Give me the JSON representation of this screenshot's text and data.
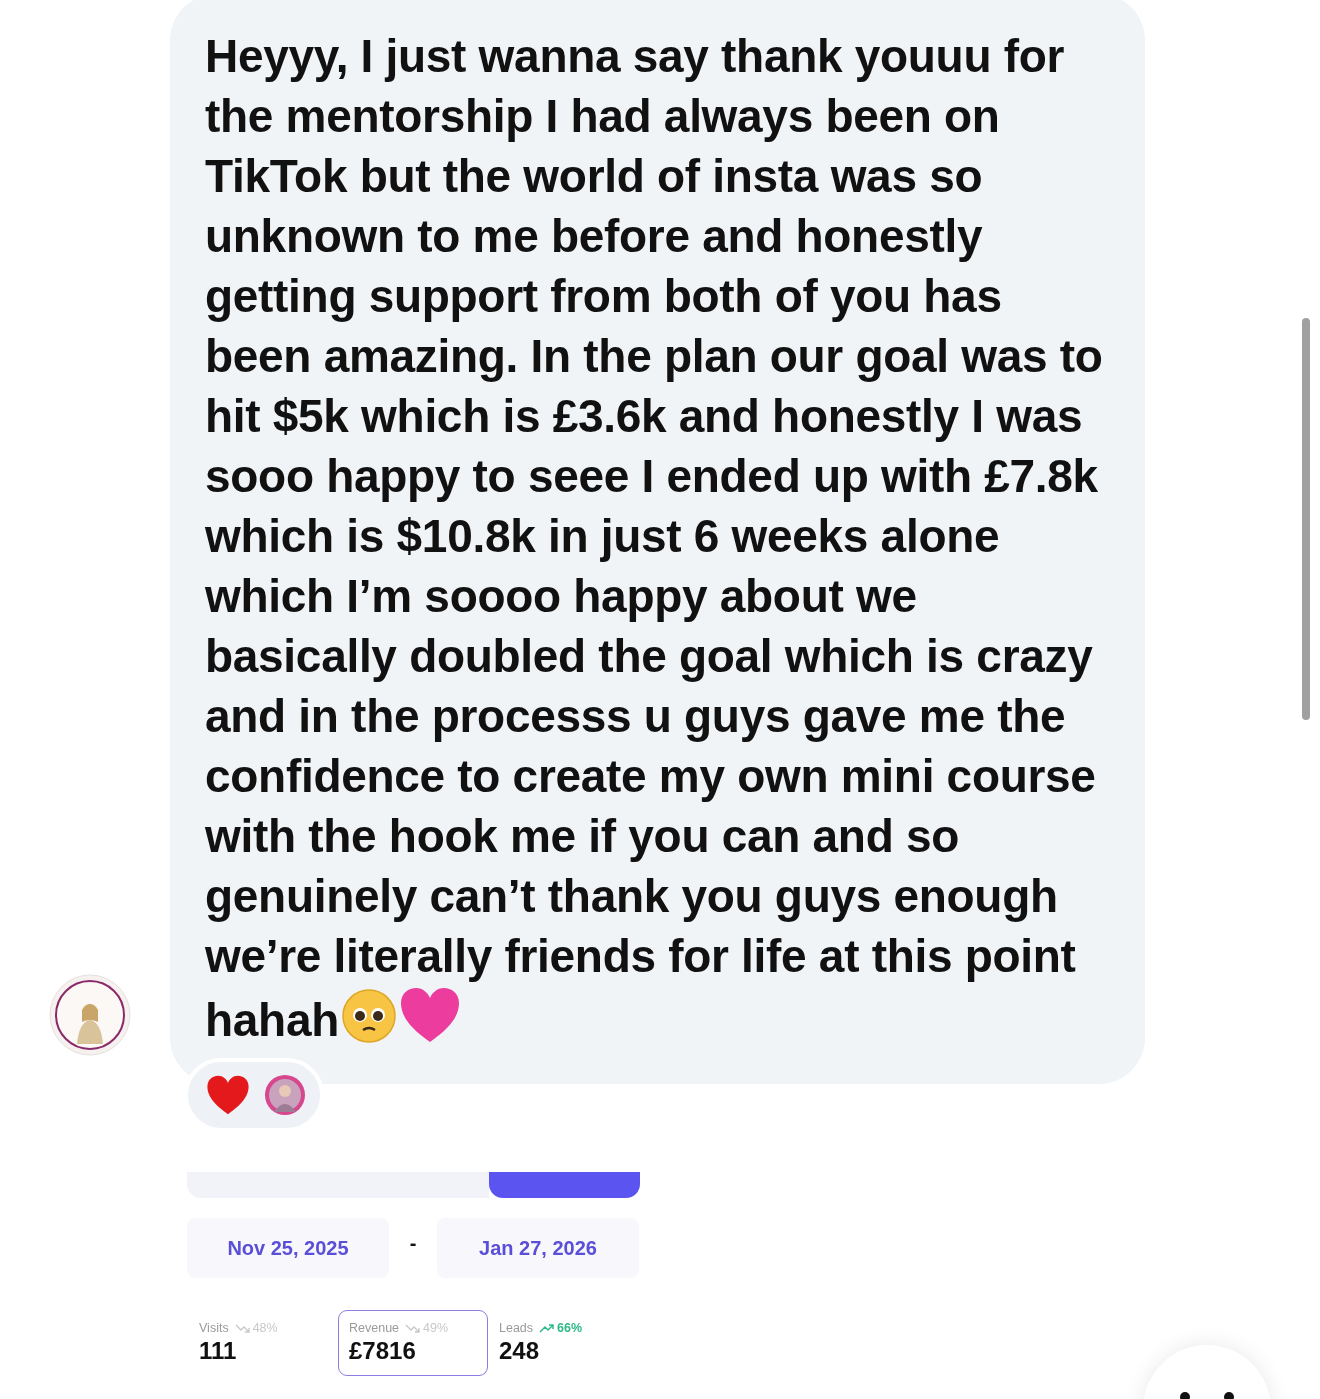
{
  "message": {
    "text": "Heyyy, I just wanna say thank youuu for the mentorship I had always been on TikTok but the world of insta was so unknown to me before and honestly getting support from both of you has been amazing. In the plan our goal was to hit $5k which is £3.6k and honestly I was sooo happy to seee I ended up with £7.8k which is $10.8k in just 6 weeks alone which I’m soooo happy about we basically doubled the goal which is crazy and in the processs u guys gave me the confidence to create my own mini course with the hook me if you can and so genuinely can’t thank you guys enough we’re literally friends for life at this point hahah"
  },
  "segments": [
    {
      "selected": false
    },
    {
      "selected": false
    },
    {
      "selected": true
    }
  ],
  "date_range": {
    "start": "Nov 25, 2025",
    "separator": "-",
    "end": "Jan 27, 2026"
  },
  "stats": [
    {
      "label": "Visits",
      "kind": "down",
      "change": "48%",
      "value": "111",
      "selected": false
    },
    {
      "label": "Revenue",
      "kind": "down",
      "change": "49%",
      "value": "£7816",
      "selected": true
    },
    {
      "label": "Leads",
      "kind": "up",
      "change": "66%",
      "value": "248",
      "selected": false
    }
  ]
}
